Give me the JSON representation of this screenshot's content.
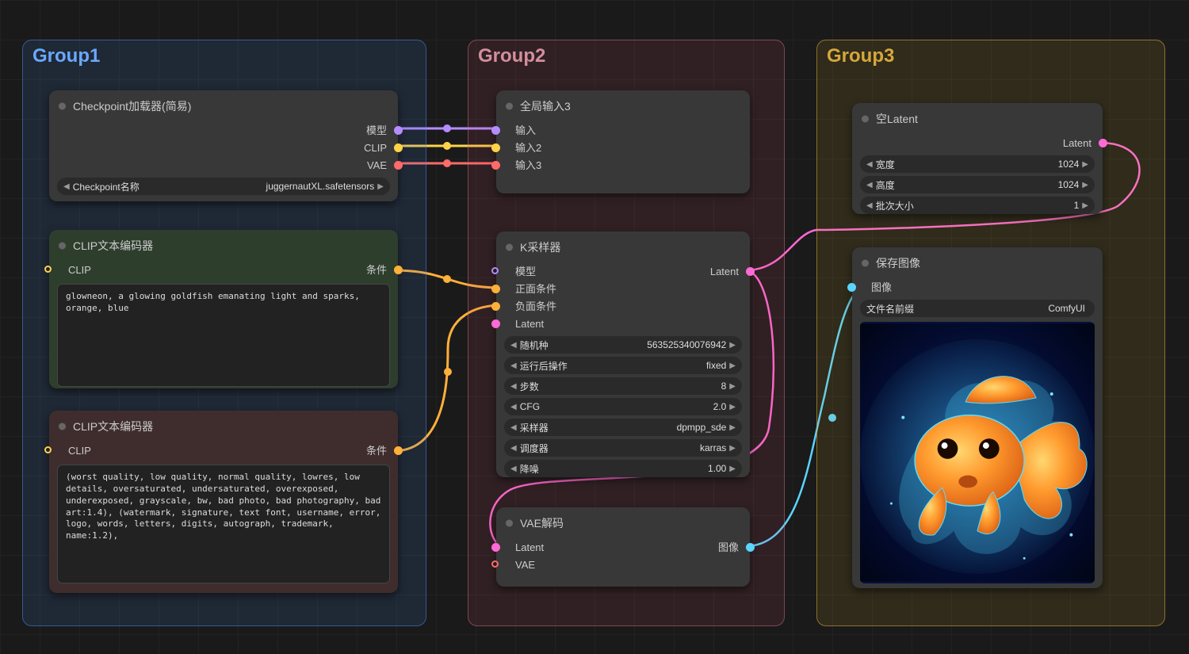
{
  "groups": {
    "g1": "Group1",
    "g2": "Group2",
    "g3": "Group3"
  },
  "checkpoint": {
    "title": "Checkpoint加载器(简易)",
    "out_model": "模型",
    "out_clip": "CLIP",
    "out_vae": "VAE",
    "param_name": "Checkpoint名称",
    "param_value": "juggernautXL.safetensors"
  },
  "clip_pos": {
    "title": "CLIP文本编码器",
    "in_clip": "CLIP",
    "out_cond": "条件",
    "text": "glowneon, a glowing goldfish emanating light and sparks, orange, blue"
  },
  "clip_neg": {
    "title": "CLIP文本编码器",
    "in_clip": "CLIP",
    "out_cond": "条件",
    "text": "(worst quality, low quality, normal quality, lowres, low details, oversaturated, undersaturated, overexposed, underexposed, grayscale, bw, bad photo, bad photography, bad art:1.4), (watermark, signature, text font, username, error, logo, words, letters, digits, autograph, trademark, name:1.2),"
  },
  "reroute": {
    "title": "全局输入3",
    "in1": "输入",
    "in2": "输入2",
    "in3": "输入3"
  },
  "ksampler": {
    "title": "K采样器",
    "in_model": "模型",
    "in_pos": "正面条件",
    "in_neg": "负面条件",
    "in_latent": "Latent",
    "out_latent": "Latent",
    "params": {
      "seed_l": "随机种",
      "seed_v": "563525340076942",
      "after_l": "运行后操作",
      "after_v": "fixed",
      "steps_l": "步数",
      "steps_v": "8",
      "cfg_l": "CFG",
      "cfg_v": "2.0",
      "sampler_l": "采样器",
      "sampler_v": "dpmpp_sde",
      "sched_l": "调度器",
      "sched_v": "karras",
      "denoise_l": "降噪",
      "denoise_v": "1.00"
    }
  },
  "vaedec": {
    "title": "VAE解码",
    "in_latent": "Latent",
    "in_vae": "VAE",
    "out_image": "图像"
  },
  "latent": {
    "title": "空Latent",
    "out_latent": "Latent",
    "w_l": "宽度",
    "w_v": "1024",
    "h_l": "高度",
    "h_v": "1024",
    "b_l": "批次大小",
    "b_v": "1"
  },
  "save": {
    "title": "保存图像",
    "in_image": "图像",
    "prefix_l": "文件名前缀",
    "prefix_v": "ComfyUI"
  },
  "colors": {
    "model": "#b58cff",
    "clip": "#ffd24a",
    "vae": "#ff6a6a",
    "cond": "#ffb03a",
    "latent": "#ff6ad5",
    "image": "#5ad5ff"
  }
}
